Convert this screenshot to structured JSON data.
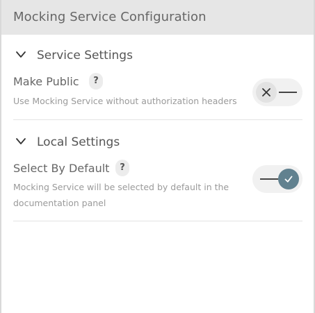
{
  "header": {
    "title": "Mocking Service Configuration"
  },
  "sections": [
    {
      "title": "Service Settings",
      "expanded": true,
      "settings": [
        {
          "label": "Make Public",
          "help": "?",
          "description": "Use Mocking Service without authorization headers",
          "enabled": false
        }
      ]
    },
    {
      "title": "Local Settings",
      "expanded": true,
      "settings": [
        {
          "label": "Select By Default",
          "help": "?",
          "description_line1": "Mocking Service will be selected by default in the",
          "description_line2": "documentation panel",
          "enabled": true
        }
      ]
    }
  ],
  "colors": {
    "header_bg": "#e6e6e6",
    "toggle_on": "#61818f",
    "toggle_off_knob": "#e2e2e2"
  },
  "icons": {
    "section_toggle": "chevron-down-icon",
    "help": "help-icon",
    "toggle_off": "close-icon",
    "toggle_on": "check-icon"
  }
}
